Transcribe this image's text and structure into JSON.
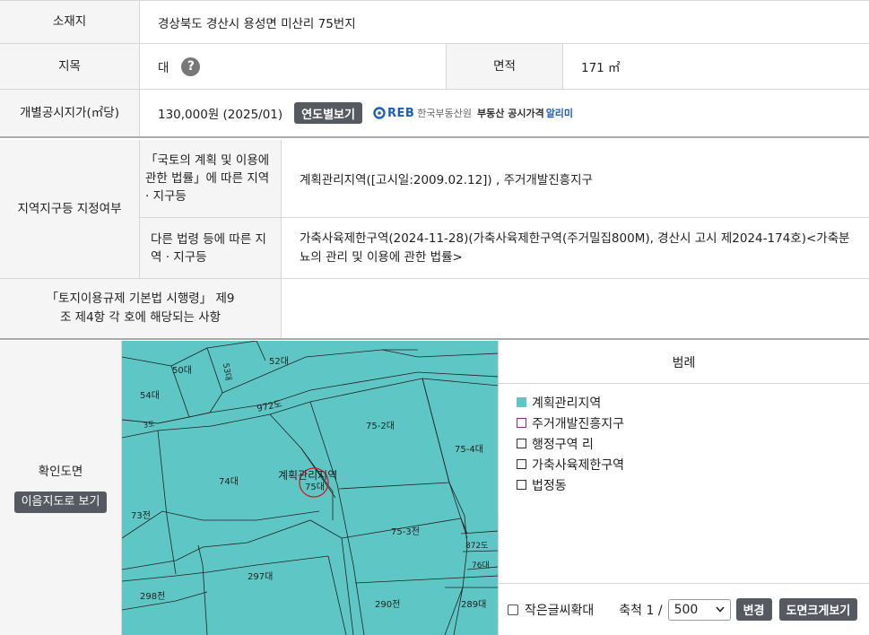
{
  "location": {
    "label": "소재지",
    "value": "경상북도 경산시 용성면 미산리 75번지"
  },
  "land_category": {
    "label": "지목",
    "value": "대",
    "help": "?"
  },
  "area": {
    "label": "면적",
    "value": "171 ㎡"
  },
  "price": {
    "label": "개별공시지가(㎡당)",
    "value": "130,000원 (2025/01)",
    "yearly_button": "연도별보기",
    "reb_logo": "REB",
    "reb_name": "한국부동산원",
    "reb_service": "부동산 공시가격",
    "reb_service_highlight": "알리미"
  },
  "zoning": {
    "label": "지역지구등 지정여부",
    "sub1_label": "「국토의 계획 및 이용에 관한 법률」에 따른 지역 · 지구등",
    "sub1_value": "계획관리지역([고시일:2009.02.12]) , 주거개발진흥지구",
    "sub2_label": "다른 법령 등에 따른 지역 · 지구등",
    "sub2_value": "가축사육제한구역(2024-11-28)(가축사육제한구역(주거밀집800M), 경산시 고시 제2024-174호)<가축분뇨의 관리 및 이용에 관한 법률>"
  },
  "enforcement": {
    "label": "「토지이용규제 기본법 시행령」 제9조 제4항 각 호에 해당되는 사항",
    "value": ""
  },
  "map_section": {
    "label": "확인도면",
    "view_button": "이음지도로 보기",
    "map_zone_label": "계획관리지역",
    "parcels": [
      "50대",
      "52대",
      "53대",
      "54대",
      "972도",
      "75-2대",
      "75-4대",
      "74대",
      "75대",
      "73전",
      "75-3전",
      "872도",
      "76대",
      "297대",
      "298전",
      "290전",
      "289대",
      "3도"
    ],
    "legend_title": "범례",
    "legend": [
      {
        "label": "계획관리지역",
        "color": "#5fc6c6",
        "filled": true
      },
      {
        "label": "주거개발진흥지구",
        "color": "#8b2d8b",
        "filled": false
      },
      {
        "label": "행정구역 리",
        "color": "#333333",
        "filled": false
      },
      {
        "label": "가축사육제한구역",
        "color": "#333333",
        "filled": false
      },
      {
        "label": "법정동",
        "color": "#333333",
        "filled": false
      }
    ],
    "small_text_label": "작은글씨확대",
    "scale_label": "축척 1 /",
    "scale_value": "500",
    "change_button": "변경",
    "enlarge_button": "도면크게보기"
  }
}
